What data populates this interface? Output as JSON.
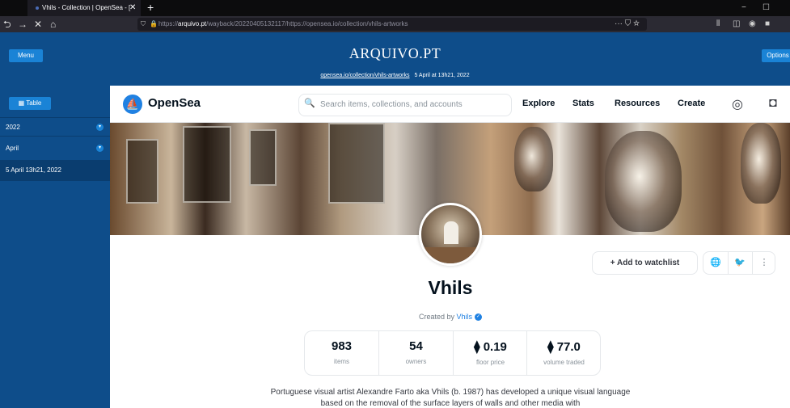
{
  "browser": {
    "tab_title": "Vhils - Collection | OpenSea - [",
    "tab_close": "✕",
    "new_tab": "+",
    "url_prefix": "https://",
    "url_domain": "arquivo.pt",
    "url_rest": "/wayback/20220405132117/https://opensea.io/collection/vhils-artworks",
    "url_actions": "··· ⛉ ☆",
    "window_controls": {
      "minimize": "−",
      "maximize": "☐"
    }
  },
  "arquivo": {
    "menu_label": "Menu",
    "options_label": "Options",
    "logo": "ARQUIVO.PT",
    "archived_link": "opensea.io/collection/vhils-artworks",
    "archived_date": "5 April at 13h21, 2022"
  },
  "sidebar": {
    "table_label": "▦ Table",
    "year": "2022",
    "month": "April",
    "selected_date": "5 April 13h21, 2022"
  },
  "opensea": {
    "brand": "OpenSea",
    "search_placeholder": "Search items, collections, and accounts",
    "nav": [
      "Explore",
      "Stats",
      "Resources",
      "Create"
    ]
  },
  "collection": {
    "name": "Vhils",
    "created_by_label": "Created by",
    "creator": "Vhils",
    "watchlist_label": "+   Add to watchlist",
    "stats": [
      {
        "value": "983",
        "label": "items"
      },
      {
        "value": "54",
        "label": "owners"
      },
      {
        "value": "⧫ 0.19",
        "label": "floor price"
      },
      {
        "value": "⧫ 77.0",
        "label": "volume traded"
      }
    ],
    "description": "Portuguese visual artist Alexandre Farto aka Vhils (b. 1987) has developed a unique visual language based on the removal of the surface layers of walls and other media with"
  },
  "colors": {
    "opensea_blue": "#2081e2",
    "arquivo_blue": "#0e4d8a",
    "arquivo_button": "#1a83d6"
  }
}
